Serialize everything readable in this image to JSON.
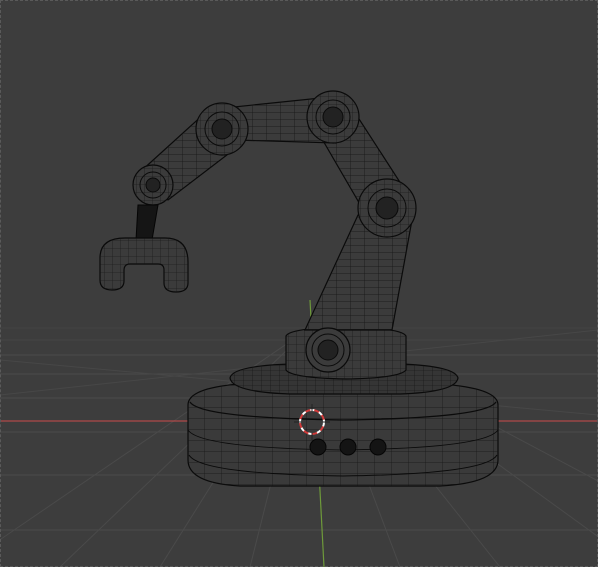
{
  "viewport": {
    "mode": "wireframe",
    "background_color": "#3d3d3d",
    "grid_color": "#4a4a4a",
    "x_axis_color": "#b04a4a",
    "y_axis_color": "#6e9a3a",
    "wire_color": "#0a0a0a",
    "mesh_fill": "#3a3a3a"
  },
  "scene": {
    "object": "robotic-arm",
    "cursor_3d": "3d-cursor-icon"
  }
}
